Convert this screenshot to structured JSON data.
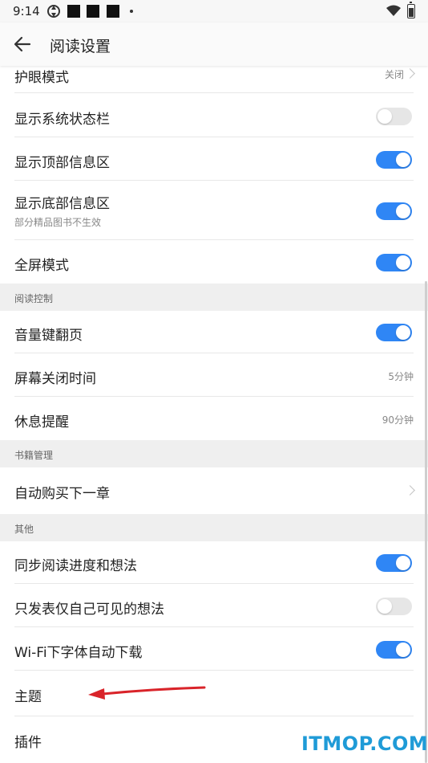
{
  "status_bar": {
    "time": "9:14"
  },
  "header": {
    "title": "阅读设置"
  },
  "rows_top": [
    {
      "label": "护眼模式",
      "value": "关闭"
    },
    {
      "label": "显示系统状态栏",
      "toggle": false
    },
    {
      "label": "显示顶部信息区",
      "toggle": true
    },
    {
      "label": "显示底部信息区",
      "sublabel": "部分精品图书不生效",
      "toggle": true
    },
    {
      "label": "全屏模式",
      "toggle": true
    }
  ],
  "section_reading": {
    "title": "阅读控制",
    "rows": [
      {
        "label": "音量键翻页",
        "toggle": true
      },
      {
        "label": "屏幕关闭时间",
        "value": "5分钟"
      },
      {
        "label": "休息提醒",
        "value": "90分钟"
      }
    ]
  },
  "section_books": {
    "title": "书籍管理",
    "rows": [
      {
        "label": "自动购买下一章"
      }
    ]
  },
  "section_other": {
    "title": "其他",
    "rows": [
      {
        "label": "同步阅读进度和想法",
        "toggle": true
      },
      {
        "label": "只发表仅自己可见的想法",
        "toggle": false
      },
      {
        "label": "Wi-Fi下字体自动下载",
        "toggle": true
      },
      {
        "label": "主题"
      },
      {
        "label": "插件"
      }
    ]
  },
  "watermark": "ITMOP.COM",
  "colors": {
    "toggle_on": "#2f86f5",
    "toggle_off": "#e6e6e6",
    "annotation_arrow": "#d9242a",
    "watermark": "#1f9bd7"
  }
}
